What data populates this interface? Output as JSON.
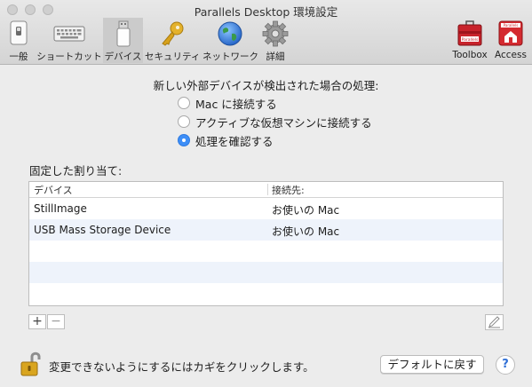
{
  "window": {
    "title": "Parallels Desktop 環境設定"
  },
  "toolbar": {
    "items": [
      {
        "label": "一般",
        "icon": "switch-icon"
      },
      {
        "label": "ショートカット",
        "icon": "keyboard-icon"
      },
      {
        "label": "デバイス",
        "icon": "usb-device-icon",
        "selected": true
      },
      {
        "label": "セキュリティ",
        "icon": "key-icon"
      },
      {
        "label": "ネットワーク",
        "icon": "globe-icon"
      },
      {
        "label": "詳細",
        "icon": "gear-icon"
      },
      {
        "label": "Toolbox",
        "icon": "toolbox-icon"
      },
      {
        "label": "Access",
        "icon": "access-icon"
      }
    ],
    "badge_text": "Parallels"
  },
  "external_device": {
    "heading": "新しい外部デバイスが検出された場合の処理:",
    "options": [
      {
        "label": "Mac に接続する",
        "checked": false
      },
      {
        "label": "アクティブな仮想マシンに接続する",
        "checked": false
      },
      {
        "label": "処理を確認する",
        "checked": true
      }
    ]
  },
  "assignments": {
    "label": "固定した割り当て:",
    "columns": [
      "デバイス",
      "接続先:"
    ],
    "rows": [
      {
        "device": "StillImage",
        "target": "お使いの Mac"
      },
      {
        "device": "USB Mass Storage Device",
        "target": "お使いの Mac"
      }
    ],
    "add_label": "+",
    "remove_label": "−"
  },
  "footer": {
    "lock_text": "変更できないようにするにはカギをクリックします。",
    "default_button": "デフォルトに戻す",
    "help_label": "?"
  },
  "colors": {
    "accent": "#3d8ef7",
    "alt_row": "#eef3fb",
    "toolbar_selected": "#cbcbcb"
  }
}
